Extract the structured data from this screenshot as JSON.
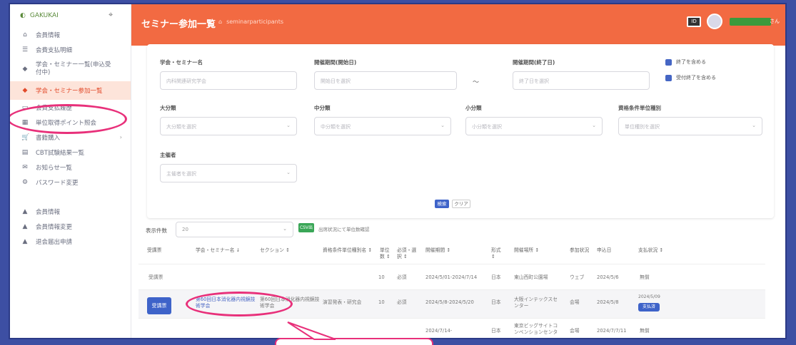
{
  "colors": {
    "accent": "#f26a42",
    "primary": "#3e63c9",
    "success": "#3aa657",
    "highlight": "#e8307a",
    "frame": "#3d4fa3"
  },
  "sidebar": {
    "logo_text": "GAKUKAI",
    "items": [
      {
        "icon": "home-icon",
        "label": "会員情報"
      },
      {
        "icon": "list-icon",
        "label": "会費支払明細"
      },
      {
        "icon": "seminar-icon",
        "label": "学会・セミナー一覧(申込受付中)"
      },
      {
        "icon": "seminar-list-icon",
        "label": "学会・セミナー参加一覧"
      },
      {
        "icon": "payment-icon",
        "label": "会費支払履歴"
      },
      {
        "icon": "points-icon",
        "label": "単位取得ポイント照会"
      },
      {
        "icon": "cart-icon",
        "label": "書籍購入"
      },
      {
        "icon": "exam-icon",
        "label": "CBT試験結果一覧"
      },
      {
        "icon": "message-icon",
        "label": "お知らせ一覧"
      },
      {
        "icon": "key-icon",
        "label": "パスワード変更"
      },
      {
        "icon": "person-icon",
        "label": "会員情報"
      },
      {
        "icon": "person-icon",
        "label": "会員情報変更"
      },
      {
        "icon": "person-icon",
        "label": "退会届出申請"
      }
    ]
  },
  "header": {
    "title": "セミナー参加一覧",
    "breadcrumb": "seminarparticipants",
    "user_suffix": "さん"
  },
  "filter": {
    "name_label": "学会・セミナー名",
    "name_placeholder": "内科関連研究学会",
    "start_label": "開催期間(開始日)",
    "start_placeholder": "開始日を選択",
    "range_sep": "〜",
    "end_label": "開催期間(終了日)",
    "end_placeholder": "終了日を選択",
    "cb1": "終了を含める",
    "cb2": "受付終了を含める",
    "l_cat": "大分類",
    "l_cat_ph": "大分類を選択",
    "m_cat": "中分類",
    "m_cat_ph": "中分類を選択",
    "s_cat": "小分類",
    "s_cat_ph": "小分類を選択",
    "credit_label": "資格条件単位種別",
    "credit_ph": "単位種別を選択",
    "host_label": "主催者",
    "host_ph": "主催者を選択",
    "search_btn": "検索",
    "clear_btn": "クリア"
  },
  "table_controls": {
    "rows_label": "表示件数",
    "rows_value": "20",
    "csv_btn": "CSV出力",
    "note": "出席状況にて単位数確認"
  },
  "table": {
    "headers": [
      "受講票",
      "学会・セミナー名 ↓",
      "セクション ↕",
      "資格条件単位種別名 ↕",
      "単位数 ↕",
      "必須・選択 ↕",
      "開催期間 ↕",
      "形式 ↕",
      "開催場所 ↕",
      "参加状況",
      "申込日",
      "支払状況 ↕"
    ],
    "rows": [
      {
        "ticket": "受講票",
        "name": "",
        "section": "",
        "credit": "",
        "units": "10",
        "req": "必須",
        "period": "2024/5/01-2024/7/14",
        "format": "日本",
        "venue": "東山西町公園場",
        "status": "ウェブ",
        "date": "2024/5/6",
        "pay": "無償"
      },
      {
        "ticket_btn": "受講票",
        "name": "第60回日本消化器内視鏡技術学会",
        "section": "第60回日本消化器内視鏡技術学会",
        "credit": "演習発表・研究会",
        "units": "10",
        "req": "必須",
        "period": "2024/5/8-2024/5/20",
        "format": "日本",
        "venue": "大阪インテックスセンター",
        "status": "会場",
        "date": "2024/5/8",
        "pay_date": "2024/5/09",
        "pay_btn": "支払済"
      },
      {
        "ticket": "",
        "name": "",
        "section": "",
        "credit": "",
        "units": "",
        "req": "",
        "period": "2024/7/14-",
        "format": "日本",
        "venue": "東京ビッグサイトコンベンションセンター",
        "status": "会場",
        "date": "2024/7/7/11",
        "pay": "無償"
      }
    ]
  }
}
